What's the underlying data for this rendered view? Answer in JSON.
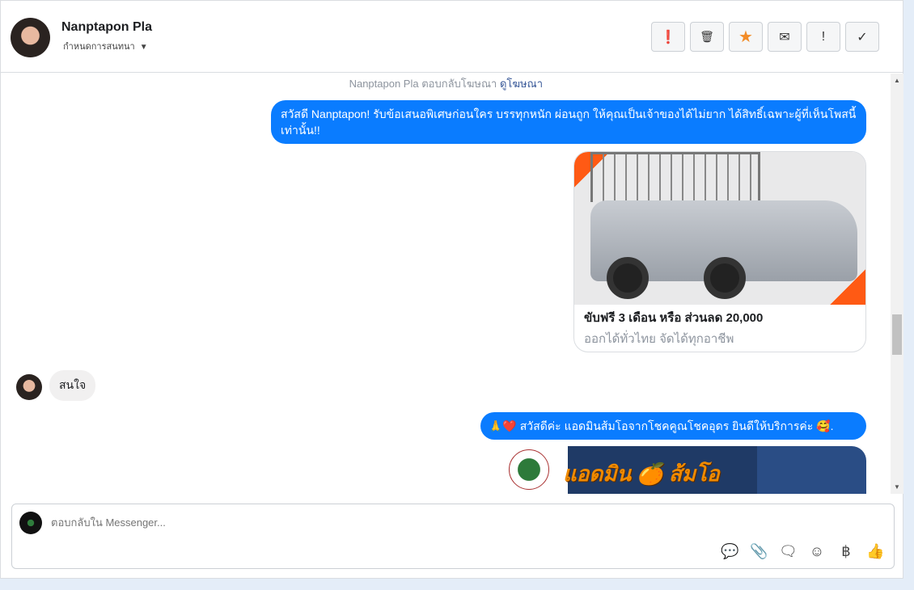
{
  "header": {
    "name": "Nanptapon Pla",
    "subtitle": "กำหนดการสนทนา",
    "buttons": [
      {
        "name": "alert",
        "glyph": "❗"
      },
      {
        "name": "trash",
        "glyph": "🗑"
      },
      {
        "name": "star",
        "glyph": "★"
      },
      {
        "name": "mail",
        "glyph": "✉"
      },
      {
        "name": "important",
        "glyph": "!"
      },
      {
        "name": "check",
        "glyph": "✓"
      }
    ]
  },
  "messages": {
    "ad_note": "Nanptapon Pla ตอบกลับโฆษณา",
    "ad_link": "ดูโฆษณา",
    "out1": "สวัสดี Nanptapon! รับข้อเสนอพิเศษก่อนใคร บรรทุกหนัก ผ่อนถูก ให้คุณเป็นเจ้าของได้ไม่ยาก ได้สิทธิ์เฉพาะผู้ที่เห็นโพสนี้เท่านั้น!!",
    "card_title": "ขับฟรี 3 เดือน หรือ ส่วนลด 20,000",
    "card_subtitle": "ออกได้ทั่วไทย จัดได้ทุกอาชีพ",
    "in1": "สนใจ",
    "out2": "🙏❤️ สวัสดีค่ะ แอดมินส้มโอจากโชคคูณโชคอุดร ยินดีให้บริการค่ะ 🥰.",
    "ad_image_text": "แอดมิน 🍊 ส้มโอ"
  },
  "composer": {
    "placeholder": "ตอบกลับใน Messenger...",
    "icons": {
      "saved_reply": "💬",
      "attach": "📎",
      "chat": "🗨",
      "emoji": "☺",
      "payment": "฿",
      "like": "👍"
    }
  },
  "colors": {
    "accent": "#0a7cff"
  }
}
